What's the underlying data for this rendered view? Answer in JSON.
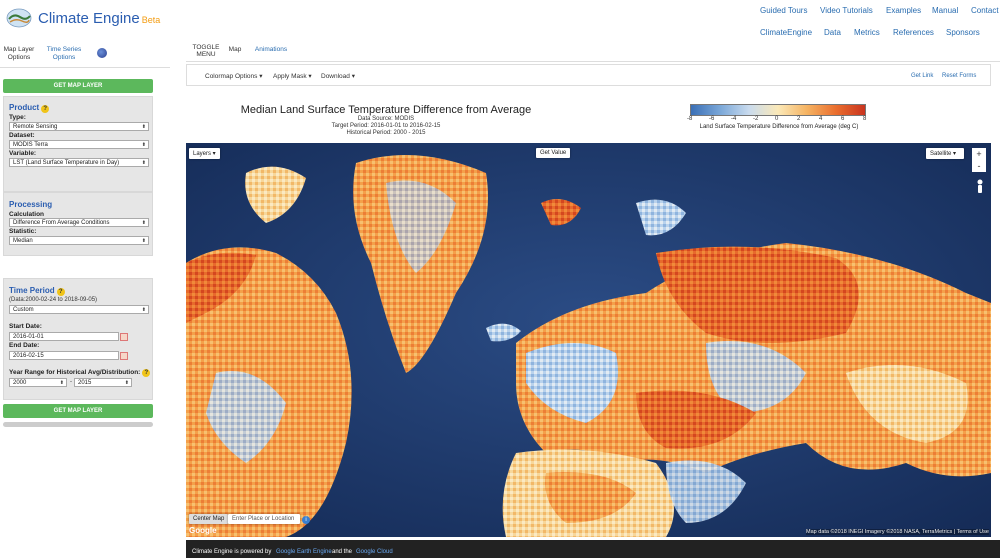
{
  "app": {
    "title": "Climate Engine",
    "beta": "Beta"
  },
  "nav": {
    "row1": [
      "Guided Tours",
      "Video Tutorials",
      "Examples",
      "Manual",
      "Contact"
    ],
    "row2": [
      "ClimateEngine",
      "Data",
      "Metrics",
      "References",
      "Sponsors"
    ]
  },
  "left_tabs": {
    "map_layer": "Map Layer Options",
    "map_layer_l1": "Map Layer",
    "map_layer_l2": "Options",
    "time_series_l1": "Time Series",
    "time_series_l2": "Options"
  },
  "get_map_layer": "GET MAP LAYER",
  "product": {
    "title": "Product",
    "type_label": "Type:",
    "type_value": "Remote Sensing",
    "dataset_label": "Dataset:",
    "dataset_value": "MODIS Terra",
    "variable_label": "Variable:",
    "variable_value": "LST (Land Surface Temperature in Day)"
  },
  "processing": {
    "title": "Processing",
    "calc_label": "Calculation",
    "calc_value": "Difference From Average Conditions",
    "stat_label": "Statistic:",
    "stat_value": "Median"
  },
  "time_period": {
    "title": "Time Period",
    "data_range": "(Data:2000-02-24 to 2018-09-05)",
    "mode_value": "Custom",
    "start_label": "Start Date:",
    "start_value": "2016-01-01",
    "end_label": "End Date:",
    "end_value": "2016-02-15",
    "hist_label": "Year Range for Historical Avg/Distribution:",
    "hist_start": "2000",
    "hist_end": "2015",
    "dash": "-"
  },
  "main_tabs": {
    "toggle1": "TOGGLE",
    "toggle2": "MENU",
    "map": "Map",
    "animations": "Animations"
  },
  "toolbar": {
    "colormap": "Colormap Options",
    "apply_mask": "Apply Mask",
    "download": "Download",
    "get_link": "Get Link",
    "reset_forms": "Reset Forms"
  },
  "map_title": {
    "title": "Median Land Surface Temperature Difference from Average",
    "source": "Data Source: MODIS",
    "target": "Target Period: 2016-01-01 to 2016-02-15",
    "historical": "Historical Period: 2000 - 2015"
  },
  "legend": {
    "ticks": [
      "-8",
      "-6",
      "-4",
      "-2",
      "0",
      "2",
      "4",
      "6",
      "8"
    ],
    "caption": "Land Surface Temperature Difference from Average (deg C)",
    "colors": [
      "#3a6fb6",
      "#7aa7d8",
      "#c9dbee",
      "#fbe9b8",
      "#f5b362",
      "#ea6e2e",
      "#c9341f"
    ]
  },
  "map_controls": {
    "layers": "Layers",
    "get_value": "Get Value",
    "satellite": "Satellite",
    "zoom_in": "+",
    "zoom_out": "-",
    "center_map": "Center Map",
    "location_placeholder": "Enter Place or Location",
    "google": "Google",
    "attribution": "Map data ©2018 INEGI Imagery ©2018 NASA, TerraMetrics | Terms of Use"
  },
  "footer": {
    "p1": "Climate Engine is powered by",
    "gee": "Google Earth Engine",
    "and": "and the",
    "gc": "Google Cloud"
  }
}
